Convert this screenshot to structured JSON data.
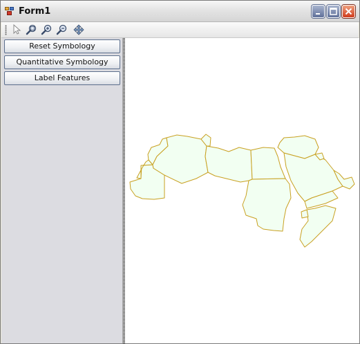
{
  "window": {
    "title": "Form1"
  },
  "titlebar_buttons": {
    "minimize": "minimize-icon",
    "maximize": "maximize-icon",
    "close": "close-icon"
  },
  "toolbar": {
    "tools": [
      {
        "name": "select-arrow-icon"
      },
      {
        "name": "zoom-extent-icon"
      },
      {
        "name": "zoom-in-icon"
      },
      {
        "name": "zoom-out-icon"
      },
      {
        "name": "pan-icon"
      }
    ]
  },
  "sidebar": {
    "buttons": [
      {
        "label": "Reset Symbology"
      },
      {
        "label": "Quantitative Symbology"
      },
      {
        "label": "Label Features"
      }
    ]
  },
  "map": {
    "fill_color": "#f2fff2",
    "stroke_color": "#c8a020"
  }
}
